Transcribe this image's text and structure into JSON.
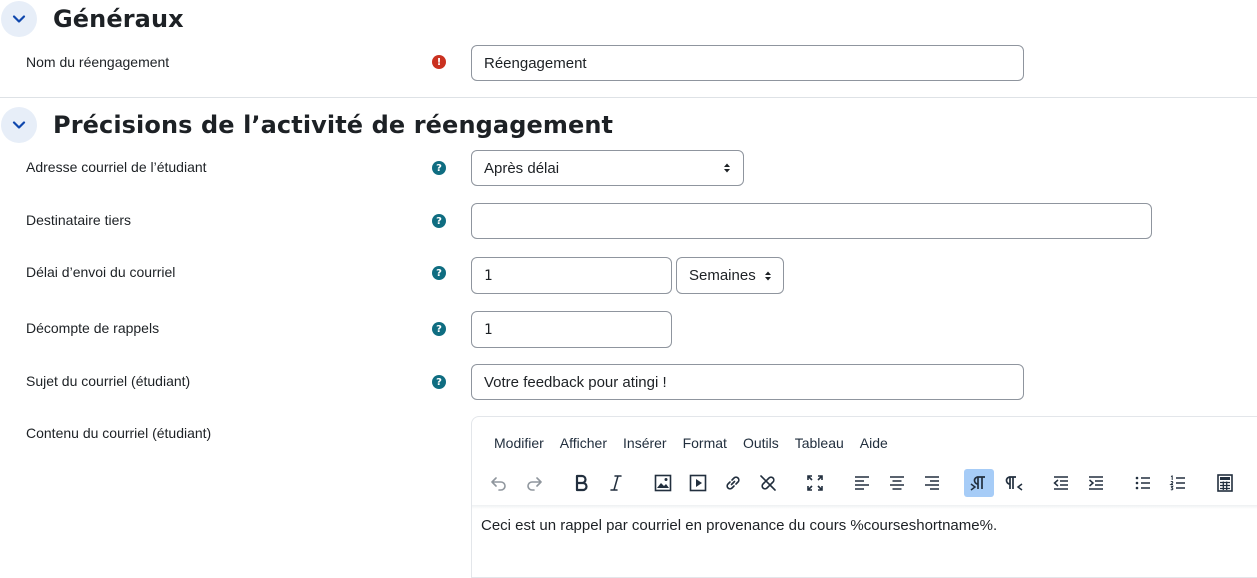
{
  "sections": {
    "general": {
      "title": "Généraux"
    },
    "details": {
      "title": "Précisions de l’activité de réengagement"
    }
  },
  "fields": {
    "name": {
      "label": "Nom du réengagement",
      "value": "Réengagement"
    },
    "student_email": {
      "label": "Adresse courriel de l’étudiant",
      "value": "Après délai"
    },
    "third_party": {
      "label": "Destinataire tiers",
      "value": ""
    },
    "delay": {
      "label": "Délai d’envoi du courriel",
      "value": "1",
      "unit": "Semaines"
    },
    "reminder_count": {
      "label": "Décompte de rappels",
      "value": "1"
    },
    "subject": {
      "label": "Sujet du courriel (étudiant)",
      "value": "Votre feedback pour atingi !"
    },
    "content": {
      "label": "Contenu du courriel (étudiant)",
      "value": "Ceci est un rappel par courriel en provenance du cours %courseshortname%."
    }
  },
  "icons": {
    "required": "!",
    "help": "?"
  },
  "editor": {
    "menu": [
      "Modifier",
      "Afficher",
      "Insérer",
      "Format",
      "Outils",
      "Tableau",
      "Aide"
    ]
  },
  "colors": {
    "help_icon": "#0f6d81",
    "required_icon": "#ca3120",
    "collapse_bg": "#e7eef8",
    "active_tool": "#a6ccf7"
  }
}
